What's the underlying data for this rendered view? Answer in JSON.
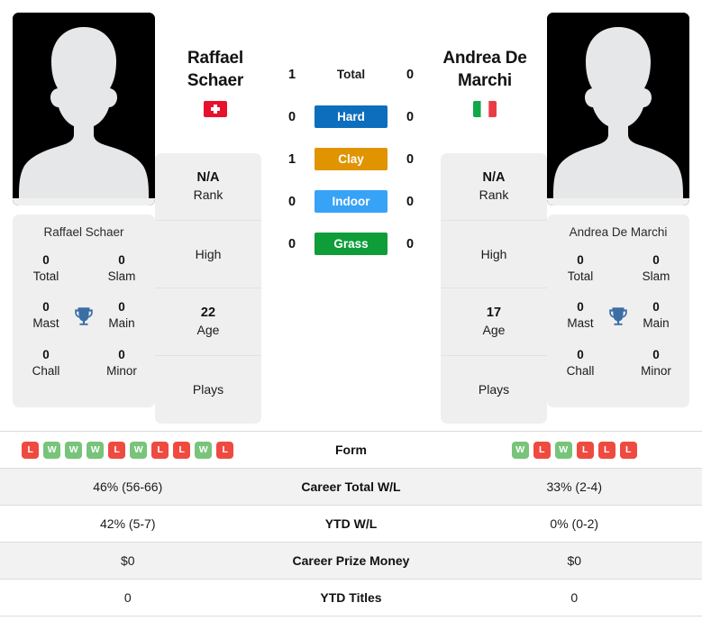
{
  "players": {
    "left": {
      "display_name": "Raffael\nSchaer",
      "name_line1": "Raffael",
      "name_line2": "Schaer",
      "full_name": "Raffael Schaer",
      "flag": "swiss-flag",
      "flag_country": "Switzerland",
      "info": {
        "rank_value": "N/A",
        "rank_label": "Rank",
        "high_value": "",
        "high_label": "High",
        "age_value": "22",
        "age_label": "Age",
        "plays_value": "",
        "plays_label": "Plays"
      },
      "titles": [
        {
          "value": "0",
          "label": "Total"
        },
        {
          "value": "0",
          "label": "Slam"
        },
        {
          "value": "0",
          "label": "Mast"
        },
        {
          "value": "0",
          "label": "Main"
        },
        {
          "value": "0",
          "label": "Chall"
        },
        {
          "value": "0",
          "label": "Minor"
        }
      ],
      "form": [
        "L",
        "W",
        "W",
        "W",
        "L",
        "W",
        "L",
        "L",
        "W",
        "L"
      ],
      "stats": {
        "career_wl": "46% (56-66)",
        "ytd_wl": "42% (5-7)",
        "career_prize_money": "$0",
        "ytd_titles": "0"
      }
    },
    "right": {
      "display_name": "Andrea De\nMarchi",
      "name_line1": "Andrea De",
      "name_line2": "Marchi",
      "full_name": "Andrea De Marchi",
      "flag": "italy-flag",
      "flag_country": "Italy",
      "info": {
        "rank_value": "N/A",
        "rank_label": "Rank",
        "high_value": "",
        "high_label": "High",
        "age_value": "17",
        "age_label": "Age",
        "plays_value": "",
        "plays_label": "Plays"
      },
      "titles": [
        {
          "value": "0",
          "label": "Total"
        },
        {
          "value": "0",
          "label": "Slam"
        },
        {
          "value": "0",
          "label": "Mast"
        },
        {
          "value": "0",
          "label": "Main"
        },
        {
          "value": "0",
          "label": "Chall"
        },
        {
          "value": "0",
          "label": "Minor"
        }
      ],
      "form": [
        "W",
        "L",
        "W",
        "L",
        "L",
        "L"
      ],
      "stats": {
        "career_wl": "33% (2-4)",
        "ytd_wl": "0% (0-2)",
        "career_prize_money": "$0",
        "ytd_titles": "0"
      }
    }
  },
  "head_to_head": [
    {
      "label": "Total",
      "left": "1",
      "right": "0",
      "badge": false,
      "color": ""
    },
    {
      "label": "Hard",
      "left": "0",
      "right": "0",
      "badge": true,
      "color": "#0d6ebd"
    },
    {
      "label": "Clay",
      "left": "1",
      "right": "0",
      "badge": true,
      "color": "#e09400"
    },
    {
      "label": "Indoor",
      "left": "0",
      "right": "0",
      "badge": true,
      "color": "#36a3f7"
    },
    {
      "label": "Grass",
      "left": "0",
      "right": "0",
      "badge": true,
      "color": "#0f9d3a"
    }
  ],
  "table": {
    "rows": [
      {
        "label": "Form",
        "left": "",
        "right": "",
        "type": "form"
      },
      {
        "label": "Career Total W/L",
        "left": "46% (56-66)",
        "right": "33% (2-4)",
        "type": "text"
      },
      {
        "label": "YTD W/L",
        "left": "42% (5-7)",
        "right": "0% (0-2)",
        "type": "text"
      },
      {
        "label": "Career Prize Money",
        "left": "$0",
        "right": "$0",
        "type": "text"
      },
      {
        "label": "YTD Titles",
        "left": "0",
        "right": "0",
        "type": "text"
      }
    ]
  },
  "icons": {
    "trophy": "trophy-icon",
    "avatar": "player-avatar-placeholder"
  },
  "colors": {
    "win": "#77c47a",
    "loss": "#ef4a40",
    "trophy": "#3a6ea5",
    "panel": "#efefef",
    "row_alt": "#f2f2f2"
  }
}
